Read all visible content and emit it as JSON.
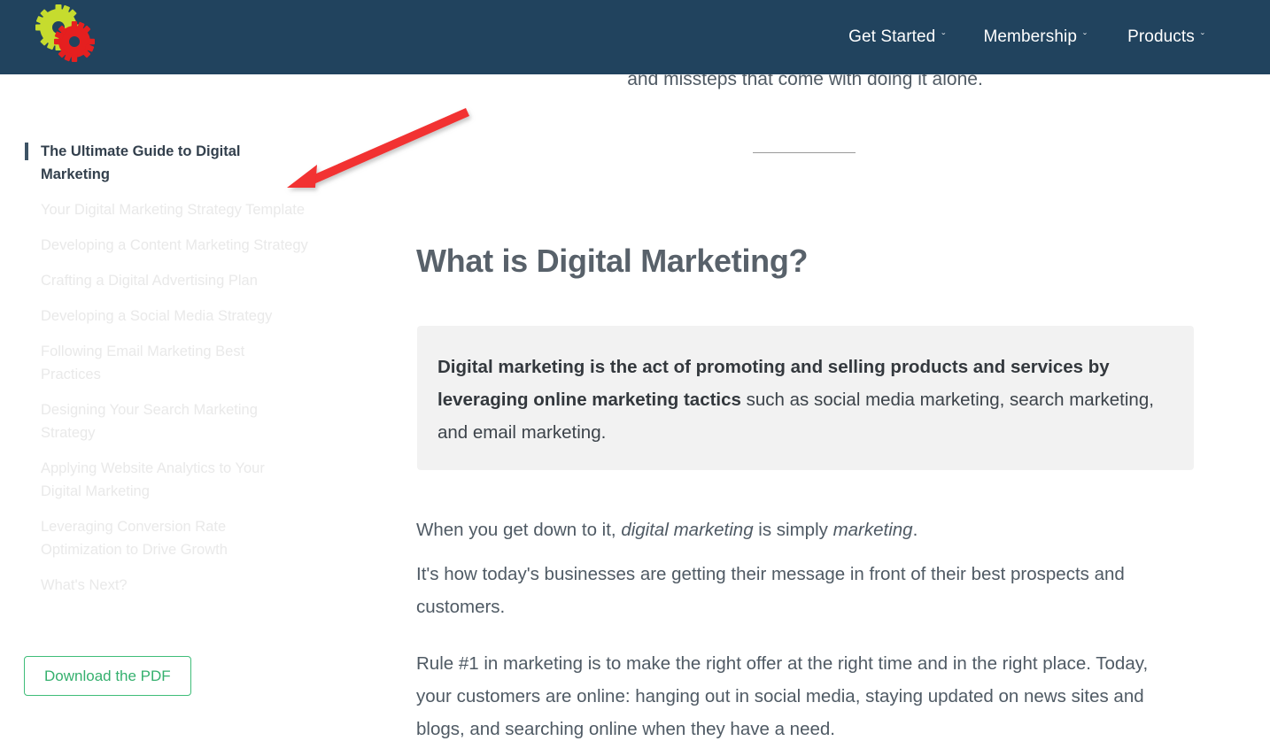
{
  "header": {
    "background_color": "#21435e",
    "logo": {
      "name": "gears-logo",
      "gear_colors": [
        "#c6dc2e",
        "#e51f1f"
      ]
    },
    "nav": [
      {
        "label": "Get Started",
        "chevron": "ˇ"
      },
      {
        "label": "Membership",
        "chevron": "ˇ"
      },
      {
        "label": "Products",
        "chevron": "ˇ"
      }
    ]
  },
  "sidebar": {
    "items": [
      {
        "label": "The Ultimate Guide to Digital Marketing",
        "active": true
      },
      {
        "label": "Your Digital Marketing Strategy Template",
        "active": false
      },
      {
        "label": "Developing a Content Marketing Strategy",
        "active": false
      },
      {
        "label": "Crafting a Digital Advertising Plan",
        "active": false
      },
      {
        "label": "Developing a Social Media Strategy",
        "active": false
      },
      {
        "label": "Following Email Marketing Best Practices",
        "active": false
      },
      {
        "label": "Designing Your Search Marketing Strategy",
        "active": false
      },
      {
        "label": "Applying Website Analytics to Your Digital Marketing",
        "active": false
      },
      {
        "label": "Leveraging Conversion Rate Optimization to Drive Growth",
        "active": false
      },
      {
        "label": "What's Next?",
        "active": false
      }
    ],
    "download_button": {
      "label": "Download the PDF",
      "text_color": "#35b06e",
      "border_color": "#3fbd79"
    },
    "active_marker_color": "#3d5365"
  },
  "main": {
    "cut_paragraph": "and missteps that come with doing it alone.",
    "heading": "What is Digital Marketing?",
    "callout": {
      "bold_text": "Digital marketing is the act of promoting and selling products and services by leveraging online marketing tactics",
      "rest_text": " such as social media marketing, search marketing, and email marketing.",
      "background_color": "#f2f2f2"
    },
    "paragraphs": [
      {
        "part1": "When you get down to it, ",
        "em1": "digital marketing",
        "part2": " is simply ",
        "em2": "marketing",
        "part3": "."
      },
      {
        "text": "It's how today's businesses are getting their message in front of their best prospects and customers."
      },
      {
        "text": "Rule #1 in marketing is to make the right offer at the right time and in the right place. Today, your customers are online: hanging out in social media, staying updated on news sites and blogs, and searching online when they have a need."
      }
    ]
  },
  "annotation": {
    "arrow_color": "#f23030",
    "direction": "down-left",
    "points_to": "sidebar-active-item"
  }
}
